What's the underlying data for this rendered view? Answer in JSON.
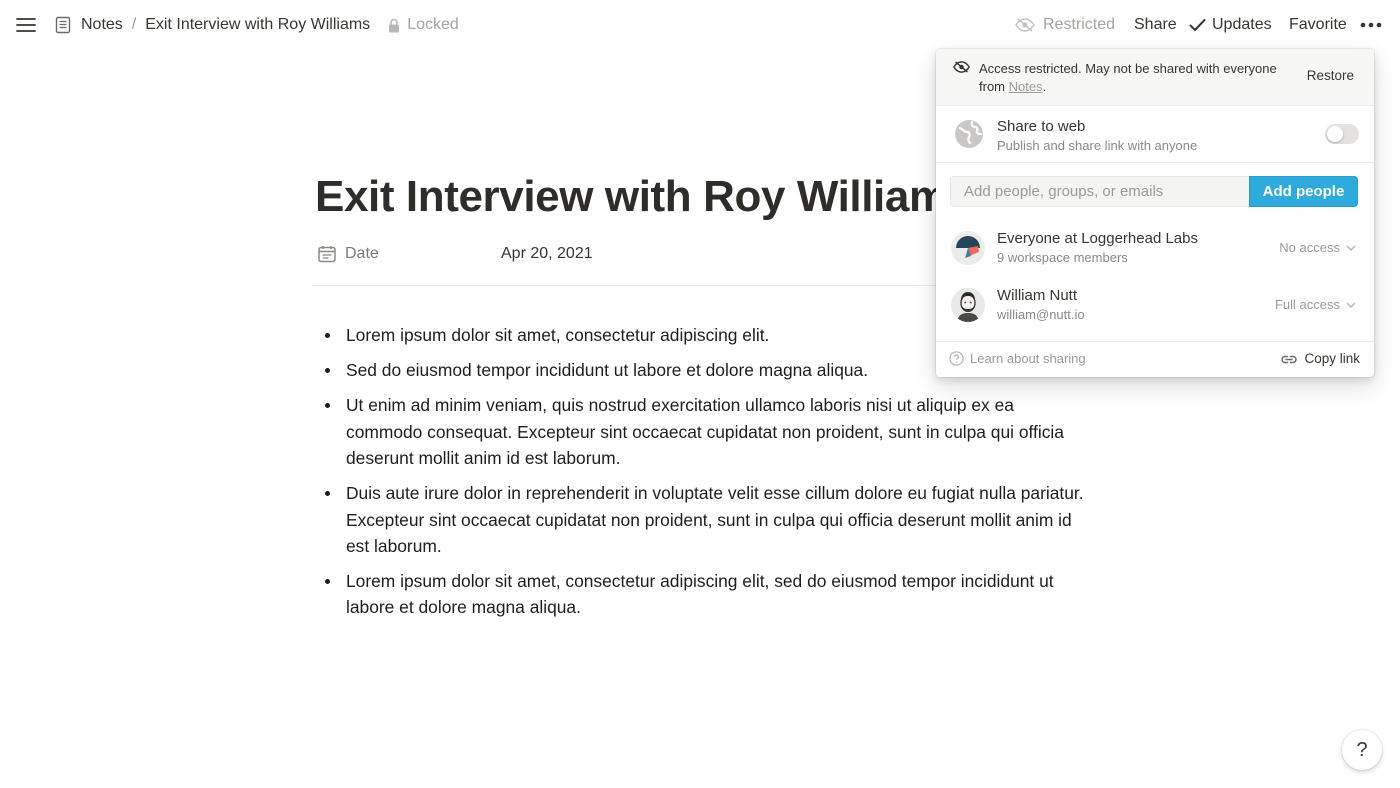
{
  "topbar": {
    "menu_icon": "hamburger-menu-icon",
    "breadcrumb": {
      "root_label": "Notes",
      "separator": "/",
      "page_label": "Exit Interview with Roy Williams"
    },
    "locked_label": "Locked",
    "restricted_label": "Restricted",
    "share_label": "Share",
    "updates_label": "Updates",
    "favorite_label": "Favorite",
    "more_label": "•••"
  },
  "page": {
    "title": "Exit Interview with Roy Williams",
    "property": {
      "label": "Date",
      "value": "Apr 20, 2021"
    },
    "bullets": [
      "Lorem ipsum dolor sit amet, consectetur adipiscing elit.",
      "Sed do eiusmod tempor incididunt ut labore et dolore magna aliqua.",
      "Ut enim ad minim veniam, quis nostrud exercitation ullamco laboris nisi ut aliquip ex ea commodo consequat.  Excepteur sint occaecat cupidatat non proident, sunt in culpa qui officia deserunt mollit anim id est laborum.",
      "Duis aute irure dolor in reprehenderit in voluptate velit esse cillum dolore eu fugiat nulla pariatur. Excepteur sint occaecat cupidatat non proident, sunt in culpa qui officia deserunt mollit anim id est laborum.",
      "Lorem ipsum dolor sit amet, consectetur adipiscing elit, sed do eiusmod tempor incididunt ut labore et dolore magna aliqua."
    ]
  },
  "share_popover": {
    "restricted": {
      "message_before": "Access restricted. May not be shared with everyone from ",
      "message_link": "Notes",
      "message_after": ".",
      "restore_label": "Restore"
    },
    "web": {
      "title": "Share to web",
      "subtitle": "Publish and share link with anyone",
      "enabled": false
    },
    "invite": {
      "placeholder": "Add people, groups, or emails",
      "button_label": "Add people"
    },
    "members": [
      {
        "name": "Everyone at Loggerhead Labs",
        "detail": "9 workspace members",
        "access": "No access"
      },
      {
        "name": "William Nutt",
        "detail": "william@nutt.io",
        "access": "Full access"
      }
    ],
    "footer": {
      "learn_label": "Learn about sharing",
      "copy_label": "Copy link"
    }
  },
  "help": {
    "label": "?"
  },
  "colors": {
    "accent": "#2eaadc",
    "text": "#37352f",
    "muted": "#9b9a97"
  }
}
